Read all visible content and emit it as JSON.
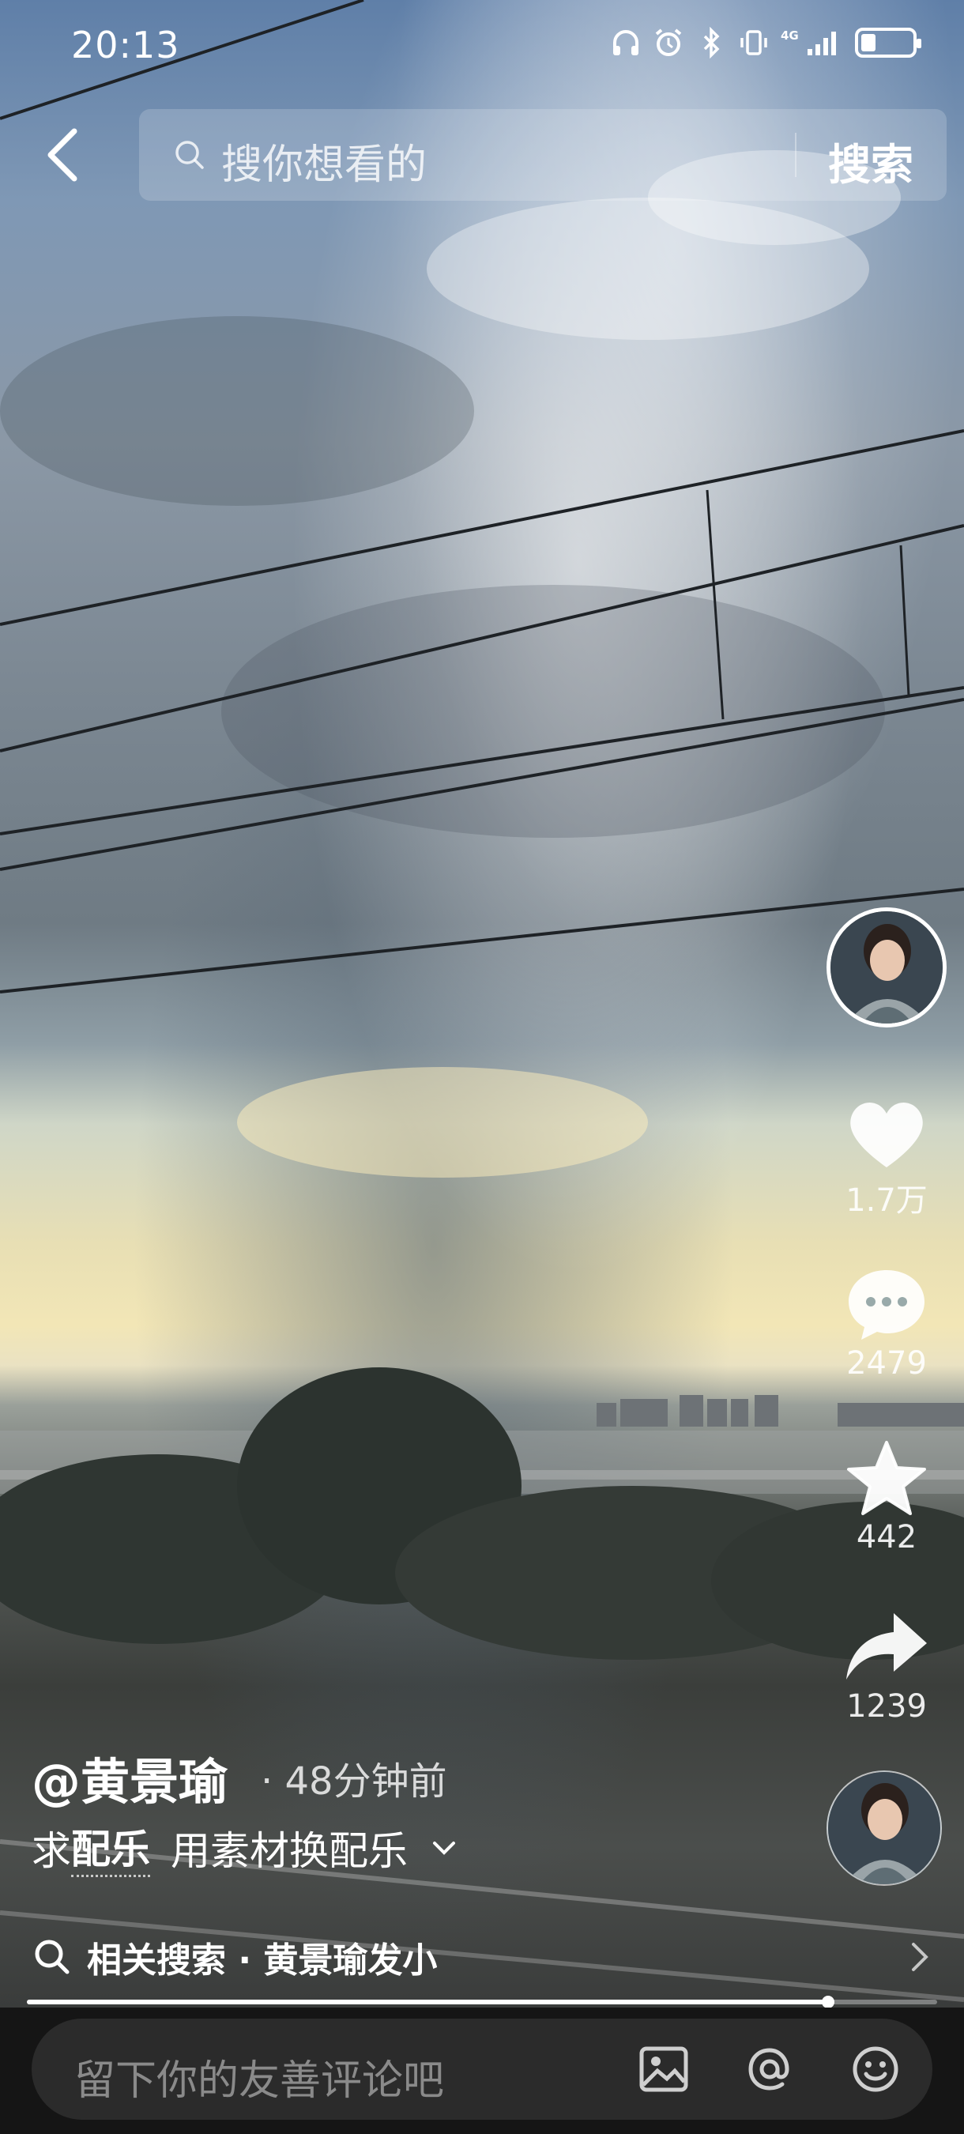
{
  "status_bar": {
    "time": "20:13",
    "icons": [
      "headphones-icon",
      "alarm-icon",
      "bluetooth-icon",
      "vibrate-icon",
      "4g-signal-icon",
      "battery-icon"
    ],
    "network": "4G"
  },
  "search": {
    "placeholder": "搜你想看的",
    "button_label": "搜索"
  },
  "rail": {
    "like_count": "1.7万",
    "comment_count": "2479",
    "favorite_count": "442",
    "share_count": "1239"
  },
  "post": {
    "author": "@黄景瑜",
    "time_ago": "· 48分钟前",
    "caption_prefix": "求",
    "caption_tag": "配乐",
    "caption_rest": "用素材换配乐"
  },
  "related_search": {
    "text": "相关搜索 · 黄景瑜发小"
  },
  "progress": {
    "fraction": 0.88
  },
  "comment_bar": {
    "placeholder": "留下你的友善评论吧"
  },
  "colors": {
    "accent": "#ffffff",
    "bottom_bar": "#151515",
    "comment_box": "#2b2b2b"
  }
}
